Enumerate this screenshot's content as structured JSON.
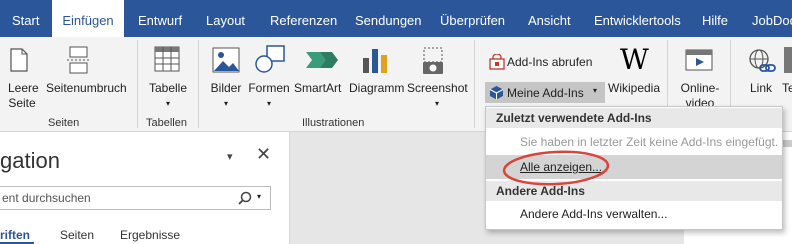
{
  "tabs": [
    "Start",
    "Einfügen",
    "Entwurf",
    "Layout",
    "Referenzen",
    "Sendungen",
    "Überprüfen",
    "Ansicht",
    "Entwicklertools",
    "Hilfe",
    "JobDocs"
  ],
  "active_tab": "Einfügen",
  "ribbon": {
    "pages": {
      "leere_seite_line1": "Leere",
      "leere_seite_line2": "Seite",
      "seitenumbruch": "Seitenumbruch",
      "group": "Seiten"
    },
    "tables": {
      "tabelle": "Tabelle",
      "group": "Tabellen"
    },
    "illustrations": {
      "bilder": "Bilder",
      "formen": "Formen",
      "smartart": "SmartArt",
      "diagramm": "Diagramm",
      "screenshot": "Screenshot",
      "group": "Illustrationen"
    },
    "addins": {
      "abrufen": "Add-Ins abrufen",
      "meine": "Meine Add-Ins",
      "wikipedia": "Wikipedia"
    },
    "media": {
      "online_video_line1": "Online-",
      "online_video_line2": "video"
    },
    "links": {
      "link": "Link",
      "te": "Te"
    }
  },
  "navpane": {
    "title": "gation",
    "search_placeholder": "ent durchsuchen",
    "tabs": [
      "riften",
      "Seiten",
      "Ergebnisse"
    ]
  },
  "dropdown": {
    "header_recent": "Zuletzt verwendete Add-Ins",
    "no_recent": "Sie haben in letzter Zeit keine Add-Ins eingefügt.",
    "show_all": "Alle anzeigen...",
    "header_other": "Andere Add-Ins",
    "manage_other": "Andere Add-Ins verwalten..."
  },
  "colors": {
    "brand_blue": "#2b579a",
    "highlight_circle": "#d9453b",
    "wiki_black": "#000000"
  }
}
